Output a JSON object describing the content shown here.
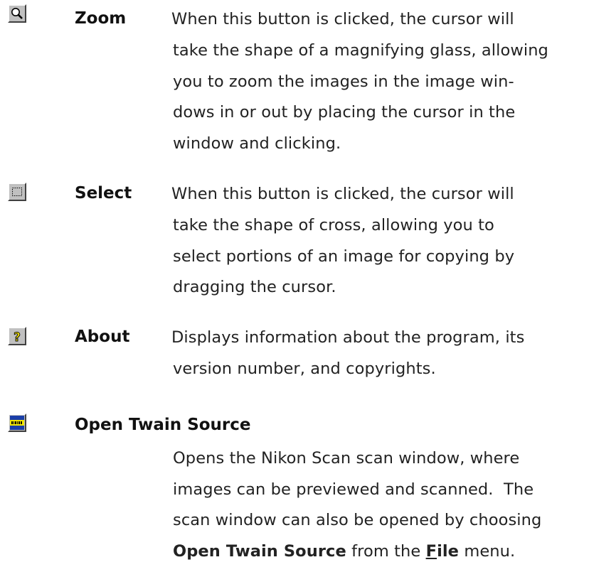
{
  "entries": [
    {
      "term": "Zoom",
      "icon": "magnifier-icon",
      "lines": [
        "When this button is clicked, the cursor will",
        "take the shape of a magnifying glass, allowing",
        "you to zoom the images in the image win-",
        "dows in or out by placing the cursor in the",
        "window and clicking."
      ]
    },
    {
      "term": "Select",
      "icon": "dotted-rectangle-icon",
      "lines": [
        "When this button is clicked, the cursor will",
        "take the shape of cross, allowing you to",
        "select portions of an image for copying by",
        "dragging the cursor."
      ]
    },
    {
      "term": "About",
      "icon": "question-mark-icon",
      "lines": [
        "Displays information about the program, its",
        "version number, and copyrights."
      ]
    },
    {
      "term": "Open Twain Source",
      "icon": "nikon-scanner-icon",
      "lines": [
        "Opens the Nikon Scan scan window, where",
        "images can be previewed and scanned.  The",
        "scan window can also be opened by choosing"
      ],
      "last_line": {
        "bold_phrase": "Open Twain Source",
        "middle": " from the ",
        "menu_letter": "F",
        "menu_rest": "ile",
        "end": " menu."
      }
    }
  ],
  "colors": {
    "button_face": "#c0c0c0",
    "nikon_icon_bg": "#1a3ea8",
    "nikon_icon_band": "#f2e600",
    "question_mark": "#f0e000"
  }
}
